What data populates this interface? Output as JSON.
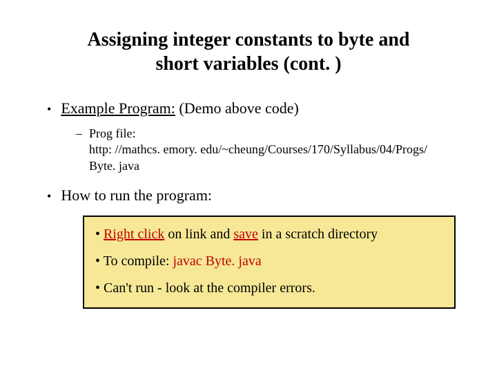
{
  "title_line1": "Assigning integer constants to byte and",
  "title_line2": "short variables (cont. )",
  "bullet1_underlined": "Example Program:",
  "bullet1_rest": " (Demo above code)",
  "sub_label": "Prog file:",
  "sub_url": "http: //mathcs. emory. edu/~cheung/Courses/170/Syllabus/04/Progs/ Byte. java",
  "bullet2": "How to run the program:",
  "box": {
    "l1_pre": "• ",
    "l1_a": "Right click",
    "l1_mid": " on link and ",
    "l1_b": "save",
    "l1_post": " in a scratch directory",
    "l2_pre": "• To compile:   ",
    "l2_cmd": "javac Byte. java",
    "l3": "• Can't run - look at the compiler errors."
  }
}
